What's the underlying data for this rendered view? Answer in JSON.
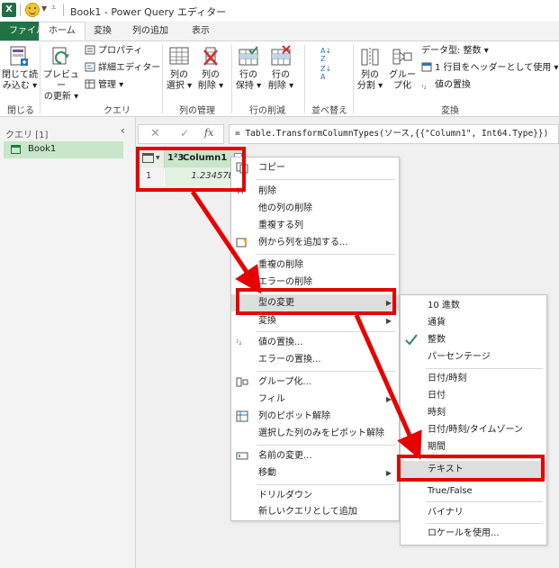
{
  "window": {
    "app_icon": "X",
    "title": "Book1 - Power Query エディター"
  },
  "tabs": [
    "ファイル",
    "ホーム",
    "変換",
    "列の追加",
    "表示"
  ],
  "ribbon": {
    "close": {
      "btn1": "閉じて読",
      "btn2": "み込む",
      "label": "閉じる"
    },
    "query": {
      "preview1": "プレビュー",
      "preview2": "の更新",
      "properties": "プロパティ",
      "advanced_editor": "詳細エディター",
      "manage": "管理",
      "label": "クエリ"
    },
    "column_mgmt": {
      "select1": "列の",
      "select2": "選択",
      "remove1": "列の",
      "remove2": "削除",
      "label": "列の管理"
    },
    "row_reduce": {
      "keep1": "行の",
      "keep2": "保持",
      "remove1": "行の",
      "remove2": "削除",
      "label": "行の削減"
    },
    "sort": {
      "label": "並べ替え"
    },
    "transform": {
      "split1": "列の",
      "split2": "分割",
      "group1": "グルー",
      "group2": "プ化",
      "data_type": "データ型: 整数",
      "header": "1 行目をヘッダーとして使用",
      "replace": "値の置換",
      "label": "変換"
    }
  },
  "queries_pane": {
    "header": "クエリ [1]",
    "items": [
      "Book1"
    ]
  },
  "formula_bar": {
    "fx": "fx",
    "formula": "= Table.TransformColumnTypes(ソース,{{\"Column1\", Int64.Type}})"
  },
  "grid": {
    "type_icon": "1²3",
    "column": "Column1",
    "rows": [
      {
        "num": "1",
        "value": "1.23457E"
      }
    ]
  },
  "context_menu": [
    "コピー",
    "削除",
    "他の列の削除",
    "重複する列",
    "例から列を追加する...",
    "重複の削除",
    "エラーの削除",
    "型の変更",
    "変換",
    "値の置換...",
    "エラーの置換...",
    "グループ化...",
    "フィル",
    "列のピボット解除",
    "選択した列のみをピボット解除",
    "名前の変更...",
    "移動",
    "ドリルダウン",
    "新しいクエリとして追加"
  ],
  "type_submenu": [
    "10 進数",
    "通貨",
    "整数",
    "パーセンテージ",
    "日付/時刻",
    "日付",
    "時刻",
    "日付/時刻/タイムゾーン",
    "期間",
    "テキスト",
    "True/False",
    "バイナリ",
    "ロケールを使用..."
  ],
  "colors": {
    "excel_green": "#217346",
    "selection_green": "#c8e6c9",
    "highlight": "#e60000"
  }
}
